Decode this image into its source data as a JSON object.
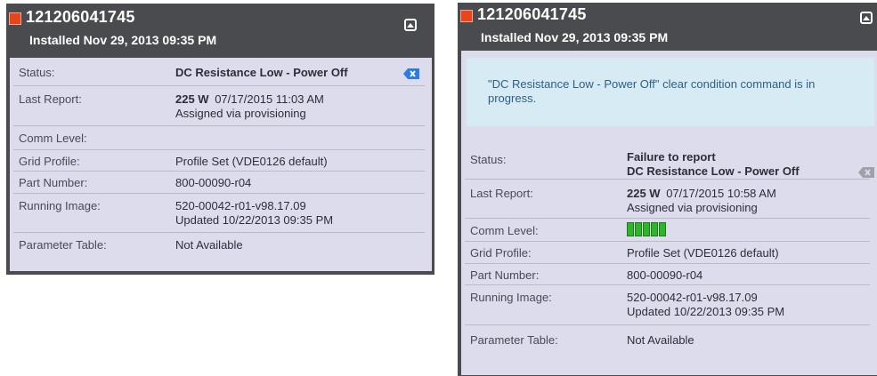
{
  "left_card": {
    "device_id": "121206041745",
    "installed": "Installed Nov 29, 2013 09:35 PM",
    "rows": {
      "status": {
        "label": "Status:",
        "value": "DC Resistance Low - Power Off"
      },
      "last_report": {
        "label": "Last Report:",
        "power": "225 W",
        "time": "07/17/2015 11:03 AM",
        "note": "Assigned via provisioning"
      },
      "comm_level": {
        "label": "Comm Level:"
      },
      "grid_profile": {
        "label": "Grid Profile:",
        "value": "Profile Set (VDE0126 default)"
      },
      "part_number": {
        "label": "Part Number:",
        "value": "800-00090-r04"
      },
      "running_image": {
        "label": "Running Image:",
        "value": "520-00042-r01-v98.17.09",
        "updated": "Updated 10/22/2013 09:35 PM"
      },
      "parameter_table": {
        "label": "Parameter Table:",
        "value": "Not Available"
      }
    }
  },
  "right_card": {
    "device_id": "121206041745",
    "installed": "Installed Nov 29, 2013 09:35 PM",
    "notice": "\"DC Resistance Low - Power Off\" clear condition command is in progress.",
    "rows": {
      "status": {
        "label": "Status:",
        "value1": "Failure to report",
        "value2": "DC Resistance Low - Power Off"
      },
      "last_report": {
        "label": "Last Report:",
        "power": "225 W",
        "time": "07/17/2015 10:58 AM",
        "note": "Assigned via provisioning"
      },
      "comm_level": {
        "label": "Comm Level:",
        "bars": 5
      },
      "grid_profile": {
        "label": "Grid Profile:",
        "value": "Profile Set (VDE0126 default)"
      },
      "part_number": {
        "label": "Part Number:",
        "value": "800-00090-r04"
      },
      "running_image": {
        "label": "Running Image:",
        "value": "520-00042-r01-v98.17.09",
        "updated": "Updated 10/22/2013 09:35 PM"
      },
      "parameter_table": {
        "label": "Parameter Table:",
        "value": "Not Available"
      }
    }
  },
  "colors": {
    "status_square": "#e8451c",
    "card_header": "#4a4b4f",
    "card_body": "#dcdcec",
    "notice_bg": "#d6ebf3",
    "clear_icon_active": "#2a7de1",
    "clear_icon_disabled": "#a0a0a8",
    "comm_bar": "#2fb52a"
  },
  "icons": {
    "status": "status-square-icon",
    "collapse": "collapse-up-icon",
    "clear": "clear-condition-icon"
  }
}
